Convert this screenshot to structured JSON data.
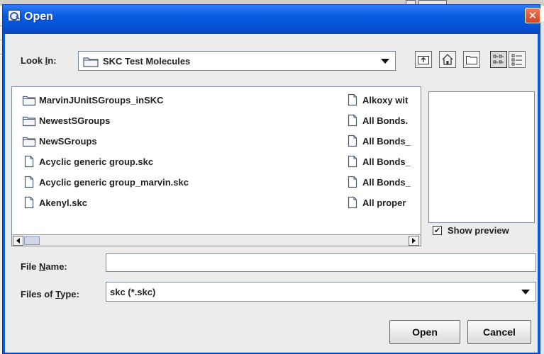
{
  "dialog": {
    "title": "Open",
    "close_glyph": "✕"
  },
  "look_in": {
    "label": "Look In:",
    "value": "SKC Test Molecules"
  },
  "toolbar": {
    "buttons": [
      "up-one-level-icon",
      "home-icon",
      "new-folder-icon",
      "list-view-icon",
      "details-view-icon"
    ]
  },
  "files": {
    "column1": [
      {
        "name": "MarvinJUnitSGroups_inSKC",
        "type": "folder"
      },
      {
        "name": "NewestSGroups",
        "type": "folder"
      },
      {
        "name": "NewSGroups",
        "type": "folder"
      },
      {
        "name": "Acyclic generic group.skc",
        "type": "file"
      },
      {
        "name": "Acyclic generic group_marvin.skc",
        "type": "file"
      },
      {
        "name": "Akenyl.skc",
        "type": "file"
      }
    ],
    "column2": [
      {
        "name": "Alkoxy wit",
        "type": "file"
      },
      {
        "name": "All Bonds.",
        "type": "file"
      },
      {
        "name": "All Bonds_",
        "type": "file"
      },
      {
        "name": "All Bonds_",
        "type": "file"
      },
      {
        "name": "All Bonds_",
        "type": "file"
      },
      {
        "name": "All proper",
        "type": "file"
      }
    ]
  },
  "preview": {
    "label": "Show preview",
    "checked": true
  },
  "file_name": {
    "label": "File Name:",
    "value": ""
  },
  "file_type": {
    "label": "Files of Type:",
    "value": "skc (*.skc)"
  },
  "buttons": {
    "open": "Open",
    "cancel": "Cancel"
  },
  "colors": {
    "title_bar": "#0554d8",
    "close_button": "#d6441f",
    "panel": "#ececec"
  }
}
